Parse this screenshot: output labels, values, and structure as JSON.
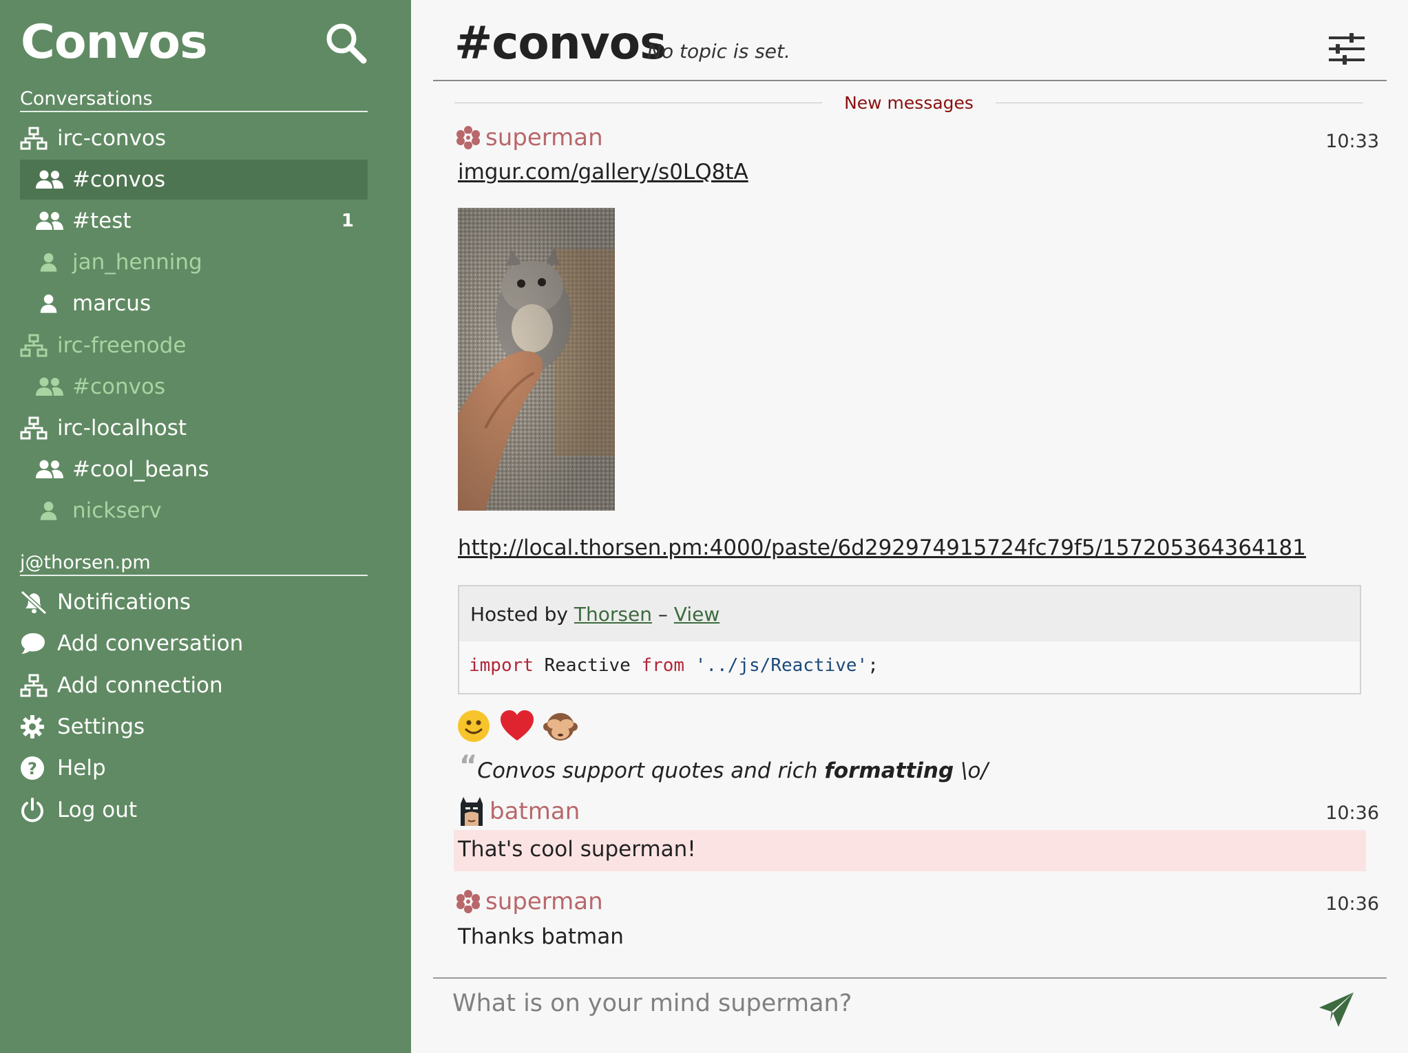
{
  "app": {
    "name": "Convos"
  },
  "sidebar": {
    "conversations_header": "Conversations",
    "items": [
      {
        "label": "irc-convos",
        "type": "connection",
        "muted": false
      },
      {
        "label": "#convos",
        "type": "channel",
        "active": true
      },
      {
        "label": "#test",
        "type": "channel",
        "badge": "1"
      },
      {
        "label": "jan_henning",
        "type": "user",
        "muted": true
      },
      {
        "label": "marcus",
        "type": "user"
      },
      {
        "label": "irc-freenode",
        "type": "connection",
        "muted": true
      },
      {
        "label": "#convos",
        "type": "channel",
        "muted": true
      },
      {
        "label": "irc-localhost",
        "type": "connection"
      },
      {
        "label": "#cool_beans",
        "type": "channel"
      },
      {
        "label": "nickserv",
        "type": "user",
        "muted": true
      }
    ],
    "account_header": "j@thorsen.pm",
    "menu": [
      {
        "label": "Notifications",
        "icon": "bell-slash-icon"
      },
      {
        "label": "Add conversation",
        "icon": "comment-icon"
      },
      {
        "label": "Add connection",
        "icon": "network-icon"
      },
      {
        "label": "Settings",
        "icon": "gear-icon"
      },
      {
        "label": "Help",
        "icon": "question-circle-icon"
      },
      {
        "label": "Log out",
        "icon": "power-icon"
      }
    ]
  },
  "header": {
    "title": "#convos",
    "topic": "No topic is set."
  },
  "divider": {
    "label": "New messages"
  },
  "messages": [
    {
      "author": "superman",
      "time": "10:33",
      "link": "imgur.com/gallery/s0LQ8tA",
      "paste_link": "http://local.thorsen.pm:4000/paste/6d292974915724fc79f5/157205364364181",
      "paste": {
        "hosted_prefix": "Hosted by",
        "host": "Thorsen",
        "sep": "–",
        "view": "View",
        "code": {
          "kw1": "import",
          "name": "Reactive",
          "kw2": "from",
          "str": "'../js/Reactive'",
          "end": ";"
        }
      },
      "emojis": [
        "🙂",
        "❤️",
        "🙈"
      ],
      "quote": {
        "text": "Convos support quotes and rich ",
        "bold": "formatting",
        "tail": " \\o/"
      }
    },
    {
      "author": "batman",
      "time": "10:36",
      "text": "That's cool superman!"
    },
    {
      "author": "superman",
      "time": "10:36",
      "text": "Thanks batman"
    }
  ],
  "composer": {
    "placeholder": "What is on your mind superman?"
  },
  "colors": {
    "sidebar": "#608a63",
    "active": "#4e7551",
    "muted": "#a9d3a2",
    "author": "#b8676b",
    "new_messages": "#8b1010",
    "highlight": "#fbe3e3"
  }
}
